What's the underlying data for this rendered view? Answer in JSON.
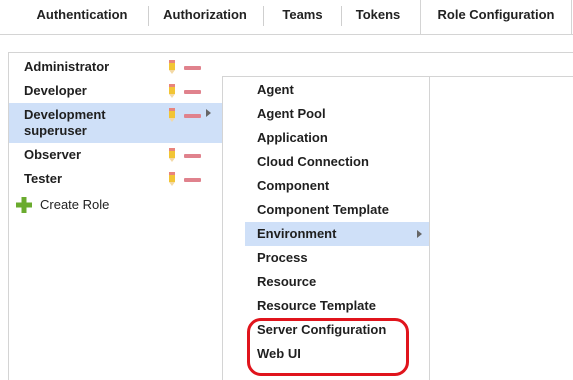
{
  "tabs": [
    {
      "label": "Authentication",
      "active": false
    },
    {
      "label": "Authorization",
      "active": false
    },
    {
      "label": "Teams",
      "active": false
    },
    {
      "label": "Tokens",
      "active": false
    },
    {
      "label": "Role Configuration",
      "active": true
    }
  ],
  "roles": [
    {
      "label": "Administrator",
      "selected": false
    },
    {
      "label": "Developer",
      "selected": false
    },
    {
      "label": "Development superuser",
      "selected": true
    },
    {
      "label": "Observer",
      "selected": false
    },
    {
      "label": "Tester",
      "selected": false
    }
  ],
  "create_role_label": "Create Role",
  "submenu": [
    {
      "label": "Agent"
    },
    {
      "label": "Agent Pool"
    },
    {
      "label": "Application"
    },
    {
      "label": "Cloud Connection"
    },
    {
      "label": "Component"
    },
    {
      "label": "Component Template"
    },
    {
      "label": "Environment",
      "selected": true,
      "has_submenu": true
    },
    {
      "label": "Process"
    },
    {
      "label": "Resource"
    },
    {
      "label": "Resource Template"
    },
    {
      "label": "Server Configuration",
      "highlighted": true
    },
    {
      "label": "Web UI",
      "highlighted": true
    }
  ],
  "colors": {
    "selection": "#cfe0f8",
    "delete_icon": "#e0828d",
    "highlight_outline": "#e0141c",
    "plus_icon": "#6aab2e"
  },
  "icons": {
    "edit": "pencil-icon",
    "delete": "minus-icon",
    "expand": "chevron-right-icon",
    "add": "plus-icon"
  }
}
